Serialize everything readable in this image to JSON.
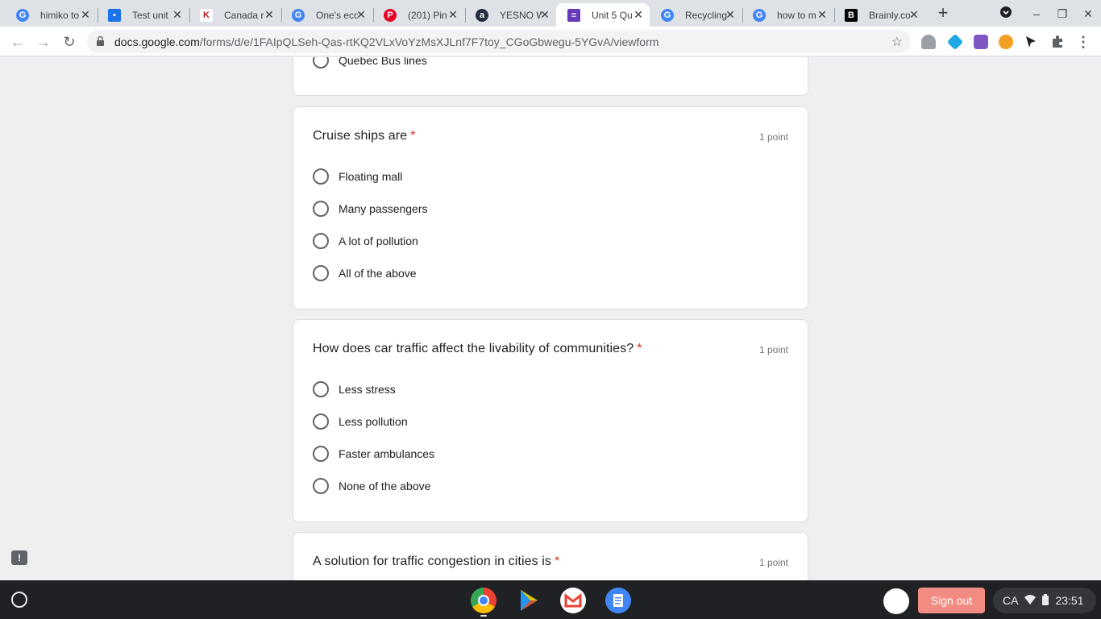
{
  "browser": {
    "tabs": [
      {
        "title": "himiko to",
        "favicon": "google-icon",
        "color": "#4285f4"
      },
      {
        "title": "Test unit",
        "favicon": "classroom-icon",
        "color": "#1a73e8"
      },
      {
        "title": "Canada r",
        "favicon": "ks-icon",
        "color": "#b31b1b"
      },
      {
        "title": "One's eco",
        "favicon": "google-icon",
        "color": "#4285f4"
      },
      {
        "title": "(201) Pin",
        "favicon": "pinterest-icon",
        "color": "#e60023"
      },
      {
        "title": "YESNO W",
        "favicon": "amazon-icon",
        "color": "#232f3e"
      },
      {
        "title": "Unit 5 Qu",
        "favicon": "forms-icon",
        "color": "#673ab7"
      },
      {
        "title": "Recycling",
        "favicon": "google-icon",
        "color": "#4285f4"
      },
      {
        "title": "how to m",
        "favicon": "google-icon",
        "color": "#4285f4"
      },
      {
        "title": "Brainly.co",
        "favicon": "brainly-icon",
        "color": "#000000"
      }
    ],
    "url_host": "docs.google.com",
    "url_path": "/forms/d/e/1FAIpQLSeh-Qas-rtKQ2VLxVoYzMsXJLnf7F7toy_CGoGbwegu-5YGvA/viewform"
  },
  "form": {
    "prev_option": "Quebec Bus lines",
    "questions": [
      {
        "title": "Cruise ships are",
        "required_mark": "*",
        "points": "1 point",
        "options": [
          "Floating mall",
          "Many passengers",
          "A lot of pollution",
          "All of the above"
        ]
      },
      {
        "title": "How does car traffic affect the livability of communities?",
        "required_mark": "*",
        "points": "1 point",
        "options": [
          "Less stress",
          "Less pollution",
          "Faster ambulances",
          "None of the above"
        ]
      },
      {
        "title": "A solution for traffic congestion in cities is",
        "required_mark": "*",
        "points": "1 point",
        "options": []
      }
    ]
  },
  "shelf": {
    "sign_out": "Sign out",
    "locale": "CA",
    "time": "23:51"
  }
}
